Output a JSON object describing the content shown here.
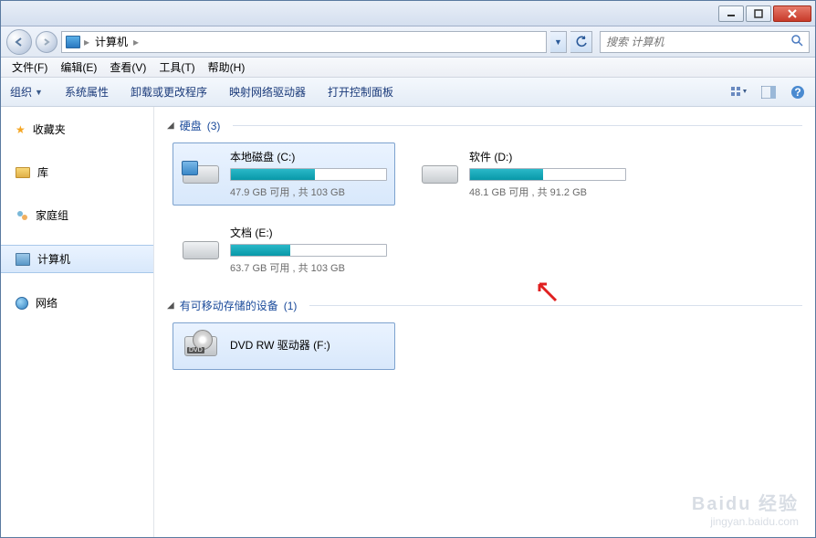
{
  "titlebar": {},
  "address": {
    "crumb": "计算机"
  },
  "search": {
    "placeholder": "搜索 计算机"
  },
  "menubar": {
    "file": "文件(F)",
    "edit": "编辑(E)",
    "view": "查看(V)",
    "tools": "工具(T)",
    "help": "帮助(H)"
  },
  "toolbar": {
    "organize": "组织",
    "sysprops": "系统属性",
    "uninstall": "卸载或更改程序",
    "mapnet": "映射网络驱动器",
    "cpanel": "打开控制面板"
  },
  "sidebar": {
    "favorites": "收藏夹",
    "libraries": "库",
    "homegroup": "家庭组",
    "computer": "计算机",
    "network": "网络"
  },
  "groups": {
    "hdd": {
      "label": "硬盘",
      "count": "(3)"
    },
    "removable": {
      "label": "有可移动存储的设备",
      "count": "(1)"
    }
  },
  "drives": {
    "c": {
      "name": "本地磁盘 (C:)",
      "stats": "47.9 GB 可用 , 共 103 GB",
      "fill_pct": 54
    },
    "d": {
      "name": "软件 (D:)",
      "stats": "48.1 GB 可用 , 共 91.2 GB",
      "fill_pct": 47
    },
    "e": {
      "name": "文档 (E:)",
      "stats": "63.7 GB 可用 , 共 103 GB",
      "fill_pct": 38
    },
    "f": {
      "name": "DVD RW 驱动器 (F:)"
    }
  },
  "watermark": {
    "brand": "Baidu 经验",
    "url": "jingyan.baidu.com"
  }
}
